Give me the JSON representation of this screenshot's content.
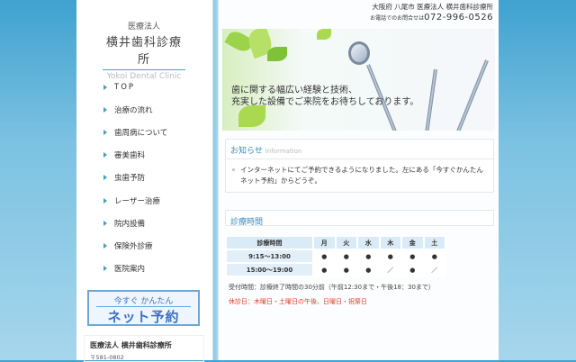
{
  "logo": {
    "small": "医療法人",
    "main": "横井歯科診療所",
    "en": "Yokoi Dental Clinic"
  },
  "nav": [
    "TOP",
    "治療の流れ",
    "歯周病について",
    "審美歯科",
    "虫歯予防",
    "レーザー治療",
    "院内設備",
    "保険外診療",
    "医院案内"
  ],
  "booking": {
    "line1": "今すぐ かんたん",
    "line2": "ネット予約"
  },
  "address": {
    "name": "医療法人 横井歯科診療所",
    "zip": "〒581-0802"
  },
  "header": {
    "location": "大阪府 八尾市 医療法人 横井歯科診療所",
    "phone_label": "お電話でのお問合せは",
    "phone": "072-996-0526"
  },
  "hero": {
    "line1": "歯に関する幅広い経験と技術、",
    "line2": "充実した設備でご来院をお待ちしております。"
  },
  "info": {
    "title": "お知らせ",
    "subtitle": "Information",
    "items": [
      "インターネットにてご予約できるようになりました。左にある「今すぐかんたんネット予約」からどうぞ。"
    ]
  },
  "hours": {
    "title": "診療時間",
    "header": [
      "診療時間",
      "月",
      "火",
      "水",
      "木",
      "金",
      "土"
    ],
    "rows": [
      [
        "9:15〜13:00",
        "●",
        "●",
        "●",
        "●",
        "●",
        "●"
      ],
      [
        "15:00〜19:00",
        "●",
        "●",
        "●",
        "／",
        "●",
        "／"
      ]
    ],
    "reception": "受付時間：診療終了時間の30分前（午前12:30まで・午後18：30まで）",
    "closed": "休診日：木曜日・土曜日の午後、日曜日・祝祭日"
  },
  "colors": {
    "accent": "#3a8ec0",
    "closed": "#e03a2a"
  }
}
